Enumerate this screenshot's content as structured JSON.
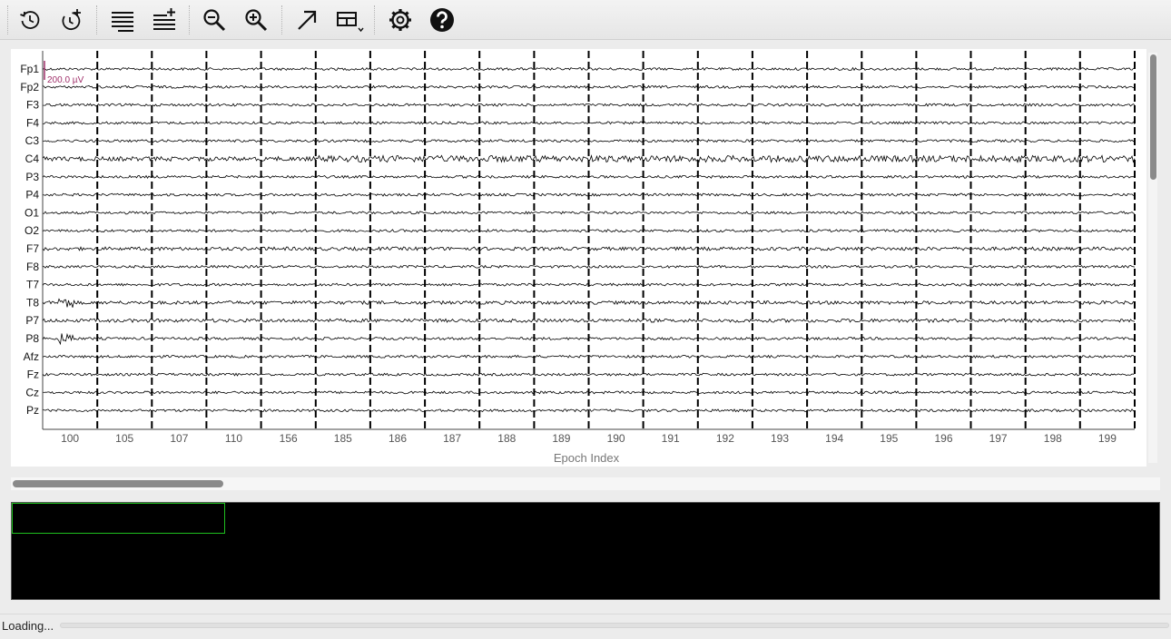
{
  "toolbar": {
    "buttons": [
      {
        "name": "history-back-button",
        "icon": "history-icon"
      },
      {
        "name": "history-add-button",
        "icon": "history-add-icon"
      },
      {
        "name": "channels-button",
        "icon": "lines-icon"
      },
      {
        "name": "channels-add-button",
        "icon": "lines-add-icon"
      },
      {
        "name": "zoom-out-button",
        "icon": "zoom-out-icon"
      },
      {
        "name": "zoom-in-button",
        "icon": "zoom-in-icon"
      },
      {
        "name": "annotate-button",
        "icon": "arrow-diagonal-icon"
      },
      {
        "name": "layout-button",
        "icon": "layout-grid-icon"
      },
      {
        "name": "settings-button",
        "icon": "gear-icon"
      },
      {
        "name": "help-button",
        "icon": "help-icon"
      }
    ]
  },
  "plot": {
    "channels": [
      "Fp1",
      "Fp2",
      "F3",
      "F4",
      "C3",
      "C4",
      "P3",
      "P4",
      "O1",
      "O2",
      "F7",
      "F8",
      "T7",
      "T8",
      "P7",
      "P8",
      "Afz",
      "Fz",
      "Cz",
      "Pz"
    ],
    "epochs": [
      "100",
      "105",
      "107",
      "110",
      "156",
      "185",
      "186",
      "187",
      "188",
      "189",
      "190",
      "191",
      "192",
      "193",
      "194",
      "195",
      "196",
      "197",
      "198",
      "199"
    ],
    "xlabel": "Epoch Index",
    "scale_label": "200.0 µV",
    "scale_color": "#a0306a"
  },
  "status": {
    "text": "Loading..."
  },
  "colors": {
    "overview_window": "#1fbf1f",
    "trace": "#000000"
  }
}
